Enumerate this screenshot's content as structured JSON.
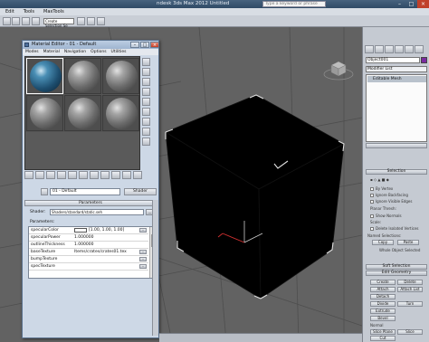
{
  "app": {
    "title": "ndesk 3ds Max 2012    Untitled",
    "search_placeholder": "Type a keyword or phrase"
  },
  "menubar": [
    "Edit",
    "Tools",
    "MaxTools"
  ],
  "toolbar": {
    "selection_set": "Create Selection Se"
  },
  "viewport": {
    "object": "black cube",
    "axis_colors": {
      "x": "#d03030",
      "z": "#cccccc"
    }
  },
  "command_panel": {
    "object_name": "Object001",
    "object_color": "#7a2aa0",
    "modifier_list": "Modifier List",
    "stack_item": "Editable Mesh",
    "rollouts": {
      "selection": "Selection",
      "soft_selection": "Soft Selection",
      "edit_geometry": "Edit Geometry"
    },
    "selection_options": [
      "By Vertex",
      "Ignore Backfacing",
      "Ignore Visible Edges",
      "Planar Thresh:",
      "Show Normals",
      "Scale:",
      "Delete Isolated Vertices"
    ],
    "named_selections_label": "Named Selections:",
    "copy_label": "Copy",
    "paste_label": "Paste",
    "selected_status": "Whole Object Selected",
    "buttons": {
      "create": "Create",
      "delete": "Delete",
      "attach": "Attach",
      "attach_list": "Attach List",
      "detach": "Detach",
      "divide": "Divide",
      "turn": "Turn",
      "extrude": "Extrude",
      "bevel": "Bevel",
      "normal": "Normal",
      "slice_plane": "Slice Plane",
      "slice": "Slice",
      "cut": "Cut",
      "split": "Split",
      "refine_ends": "Refine Ends",
      "weld": "Weld"
    }
  },
  "material_editor": {
    "title": "Material Editor - 01 - Default",
    "menu": [
      "Modes",
      "Material",
      "Navigation",
      "Options",
      "Utilities"
    ],
    "material_name": "01 - Default",
    "material_type": "Shader",
    "params_header": "Parameters",
    "shader_label": "Shader:",
    "shader_value": "Shaders/standard/static.seh",
    "parameters_label": "Parameters:",
    "parameters": [
      {
        "name": "specularColor",
        "value": "[1.00, 1.00, 1.00]",
        "kind": "color"
      },
      {
        "name": "specularPower",
        "value": "1.000000",
        "kind": "number"
      },
      {
        "name": "outlineThickness",
        "value": "1.000000",
        "kind": "number"
      },
      {
        "name": "baseTexture",
        "value": "Items/crates/crates01.tex",
        "kind": "texture"
      },
      {
        "name": "bumpTexture",
        "value": "",
        "kind": "texture"
      },
      {
        "name": "specTexture",
        "value": "",
        "kind": "texture"
      }
    ],
    "slot_count": 6,
    "active_slot": 0
  }
}
